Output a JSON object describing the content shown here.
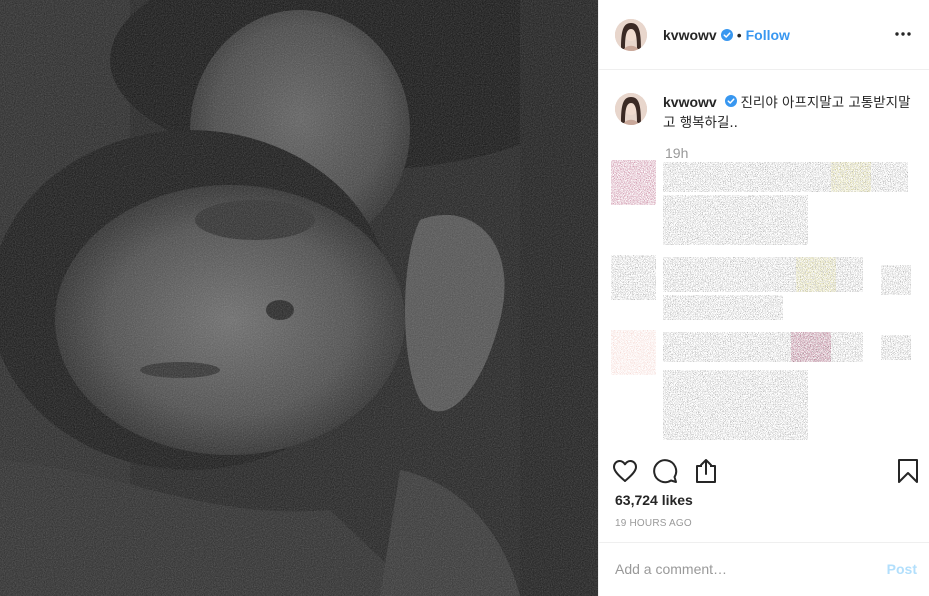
{
  "post": {
    "username": "kvwowv",
    "follow_label": "Follow",
    "separator": "•",
    "caption_text": "진리야 아프지말고 고통받지말고 행복하길..",
    "caption_time": "19h",
    "likes": "63,724 likes",
    "posted_ago": "19 HOURS AGO",
    "comment_placeholder": "Add a comment…",
    "post_button_label": "Post"
  },
  "icons": {
    "verified": "verified-badge-icon",
    "more": "more-options-icon",
    "like": "heart-icon",
    "comment": "comment-bubble-icon",
    "share": "share-icon",
    "save": "bookmark-icon"
  },
  "colors": {
    "accent": "#3897f0",
    "post_disabled": "#b2dffc",
    "muted_text": "#999999",
    "divider": "#efefef"
  }
}
